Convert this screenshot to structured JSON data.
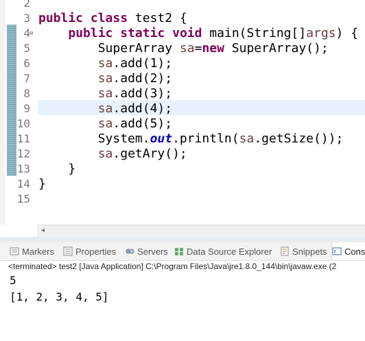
{
  "editor": {
    "lines": [
      {
        "num": "2",
        "tokens": []
      },
      {
        "num": "3",
        "tokens": [
          {
            "t": "public",
            "k": "kw"
          },
          {
            "t": " "
          },
          {
            "t": "class",
            "k": "kw"
          },
          {
            "t": " test2 {"
          }
        ]
      },
      {
        "num": "4",
        "fold": "⊖",
        "tokens": [
          {
            "t": "    "
          },
          {
            "t": "public",
            "k": "kw"
          },
          {
            "t": " "
          },
          {
            "t": "static",
            "k": "kw"
          },
          {
            "t": " "
          },
          {
            "t": "void",
            "k": "kw"
          },
          {
            "t": " main(String[]"
          },
          {
            "t": "args",
            "k": "var"
          },
          {
            "t": ") {"
          }
        ]
      },
      {
        "num": "5",
        "tokens": [
          {
            "t": "        SuperArray "
          },
          {
            "t": "sa",
            "k": "var"
          },
          {
            "t": "="
          },
          {
            "t": "new",
            "k": "kw"
          },
          {
            "t": " SuperArray();"
          }
        ]
      },
      {
        "num": "6",
        "tokens": [
          {
            "t": "        "
          },
          {
            "t": "sa",
            "k": "var"
          },
          {
            "t": ".add(1);"
          }
        ]
      },
      {
        "num": "7",
        "tokens": [
          {
            "t": "        "
          },
          {
            "t": "sa",
            "k": "var"
          },
          {
            "t": ".add(2);"
          }
        ]
      },
      {
        "num": "8",
        "tokens": [
          {
            "t": "        "
          },
          {
            "t": "sa",
            "k": "var"
          },
          {
            "t": ".add(3);"
          }
        ]
      },
      {
        "num": "9",
        "tokens": [
          {
            "t": "        "
          },
          {
            "t": "sa",
            "k": "var"
          },
          {
            "t": ".add(4);"
          }
        ]
      },
      {
        "num": "10",
        "tokens": [
          {
            "t": "        "
          },
          {
            "t": "sa",
            "k": "var"
          },
          {
            "t": ".add(5);"
          }
        ]
      },
      {
        "num": "11",
        "tokens": [
          {
            "t": "        System."
          },
          {
            "t": "out",
            "k": "fld"
          },
          {
            "t": ".println("
          },
          {
            "t": "sa",
            "k": "var"
          },
          {
            "t": ".getSize());"
          }
        ]
      },
      {
        "num": "12",
        "tokens": [
          {
            "t": "        "
          },
          {
            "t": "sa",
            "k": "var"
          },
          {
            "t": ".getAry();"
          }
        ]
      },
      {
        "num": "13",
        "tokens": [
          {
            "t": "    }"
          }
        ]
      },
      {
        "num": "14",
        "tokens": [
          {
            "t": "}"
          }
        ]
      },
      {
        "num": "15",
        "tokens": []
      }
    ],
    "current_line": "9"
  },
  "tabs": [
    {
      "label": "Markers",
      "icon": "markers-icon",
      "active": false
    },
    {
      "label": "Properties",
      "icon": "properties-icon",
      "active": false
    },
    {
      "label": "Servers",
      "icon": "servers-icon",
      "active": false
    },
    {
      "label": "Data Source Explorer",
      "icon": "data-source-explorer-icon",
      "active": false
    },
    {
      "label": "Snippets",
      "icon": "snippets-icon",
      "active": false
    },
    {
      "label": "Cons",
      "icon": "console-icon",
      "active": true
    }
  ],
  "console": {
    "header": "<terminated> test2 [Java Application] C:\\Program Files\\Java\\jre1.8.0_144\\bin\\javaw.exe (2",
    "output": [
      "5",
      "[1, 2, 3, 4, 5]"
    ]
  },
  "colors": {
    "keyword": "#7f0055",
    "static_field": "#0000c0",
    "local_var": "#6a3e3e",
    "current_line_bg": "#e8f2fe"
  }
}
